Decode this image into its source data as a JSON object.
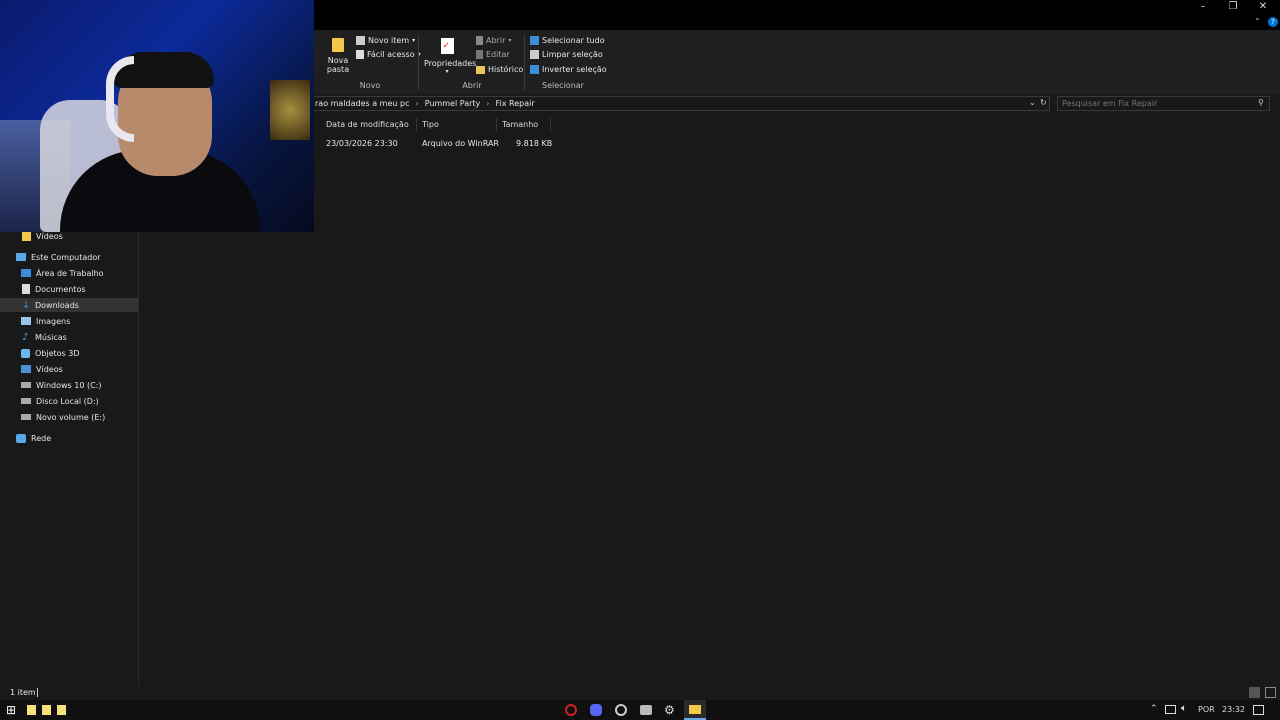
{
  "window": {
    "minimize": "–",
    "restore": "❐",
    "close": "✕"
  },
  "ribbon": {
    "new_folder": "Nova\npasta",
    "new_folder_l1": "Nova",
    "new_folder_l2": "pasta",
    "new_item": "Novo item",
    "easy_access": "Fácil acesso",
    "group_new": "Novo",
    "properties": "Propriedades",
    "open": "Abrir",
    "edit": "Editar",
    "history": "Histórico",
    "group_open": "Abrir",
    "select_all": "Selecionar tudo",
    "clear_selection": "Limpar seleção",
    "invert_selection": "Inverter seleção",
    "group_select": "Selecionar"
  },
  "address": {
    "crumbs": [
      "rao maldades a meu pc",
      "Pummel Party",
      "Fix Repair"
    ],
    "search_placeholder": "Pesquisar em Fix Repair"
  },
  "nav": {
    "items": [
      {
        "label": "Vídeos"
      },
      {
        "label": "Este Computador"
      },
      {
        "label": "Área de Trabalho"
      },
      {
        "label": "Documentos"
      },
      {
        "label": "Downloads"
      },
      {
        "label": "Imagens"
      },
      {
        "label": "Músicas"
      },
      {
        "label": "Objetos 3D"
      },
      {
        "label": "Vídeos"
      },
      {
        "label": "Windows 10 (C:)"
      },
      {
        "label": "Disco Local (D:)"
      },
      {
        "label": "Novo volume (E:)"
      },
      {
        "label": "Rede"
      }
    ]
  },
  "columns": [
    "Data de modificação",
    "Tipo",
    "Tamanho"
  ],
  "files": [
    {
      "date": "23/03/2026 23:30",
      "type": "Arquivo do WinRAR",
      "size": "9.818 KB"
    }
  ],
  "status": {
    "count": "1 item"
  },
  "taskbar": {
    "lang": "POR",
    "time": "23:32"
  },
  "colors": {
    "accent": "#0078d7",
    "folder": "#f3c84b",
    "background": "#191919"
  }
}
